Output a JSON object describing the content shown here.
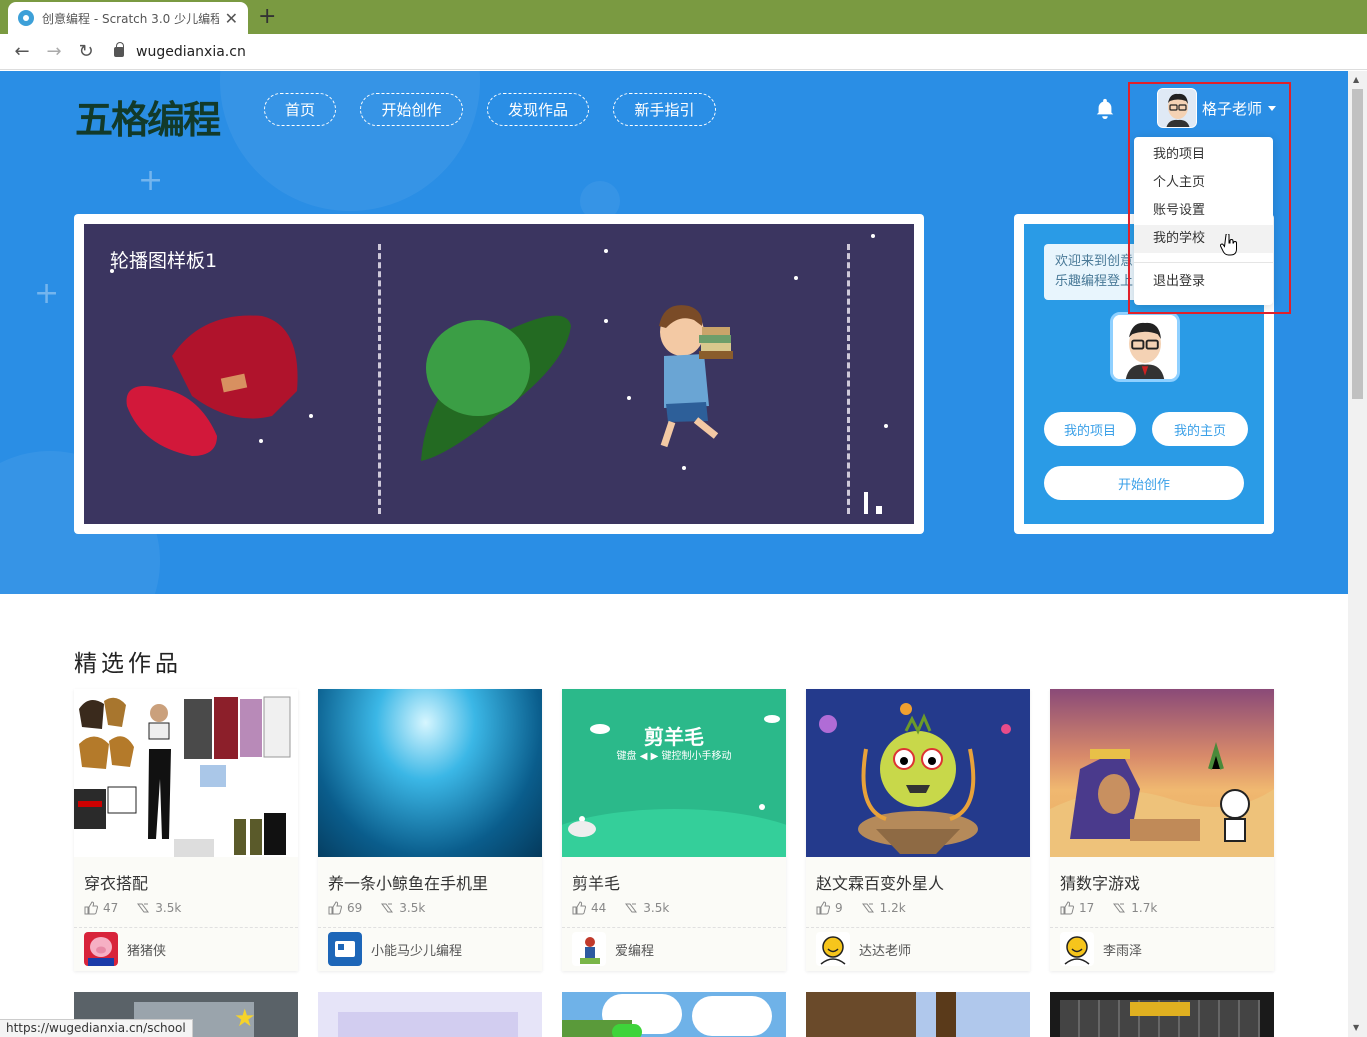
{
  "browser": {
    "tab_title": "创意编程 - Scratch 3.0 少儿编程",
    "new_tab": "+",
    "close": "✕",
    "url": "wugedianxia.cn",
    "status_url": "https://wugedianxia.cn/school"
  },
  "header": {
    "logo": "五格编程",
    "nav": [
      "首页",
      "开始创作",
      "发现作品",
      "新手指引"
    ],
    "username": "格子老师"
  },
  "user_menu": {
    "items": [
      "我的项目",
      "个人主页",
      "账号设置",
      "我的学校"
    ],
    "logout": "退出登录",
    "hovered": "我的学校"
  },
  "carousel": {
    "caption": "轮播图样板1"
  },
  "side_card": {
    "welcome_line1": "欢迎来到创意",
    "welcome_line2": "乐趣编程登上",
    "my_projects": "我的项目",
    "my_home": "我的主页",
    "start_create": "开始创作"
  },
  "featured": {
    "title": "精选作品",
    "works": [
      {
        "name": "穿衣搭配",
        "likes": "47",
        "views": "3.5k",
        "author": "猪猪侠"
      },
      {
        "name": "养一条小鲸鱼在手机里",
        "likes": "69",
        "views": "3.5k",
        "author": "小能马少儿编程"
      },
      {
        "name": "剪羊毛",
        "likes": "44",
        "views": "3.5k",
        "author": "爱编程"
      },
      {
        "name": "赵文霖百变外星人",
        "likes": "9",
        "views": "1.2k",
        "author": "达达老师"
      },
      {
        "name": "猜数字游戏",
        "likes": "17",
        "views": "1.7k",
        "author": "李雨泽"
      }
    ],
    "sheep_title": "剪羊毛",
    "sheep_sub": "键盘 ◀ ▶ 键控制小手移动"
  },
  "colors": {
    "hero_blue": "#2a8ee5",
    "highlight_red": "#e0202a",
    "tab_bar": "#7a9a41"
  }
}
